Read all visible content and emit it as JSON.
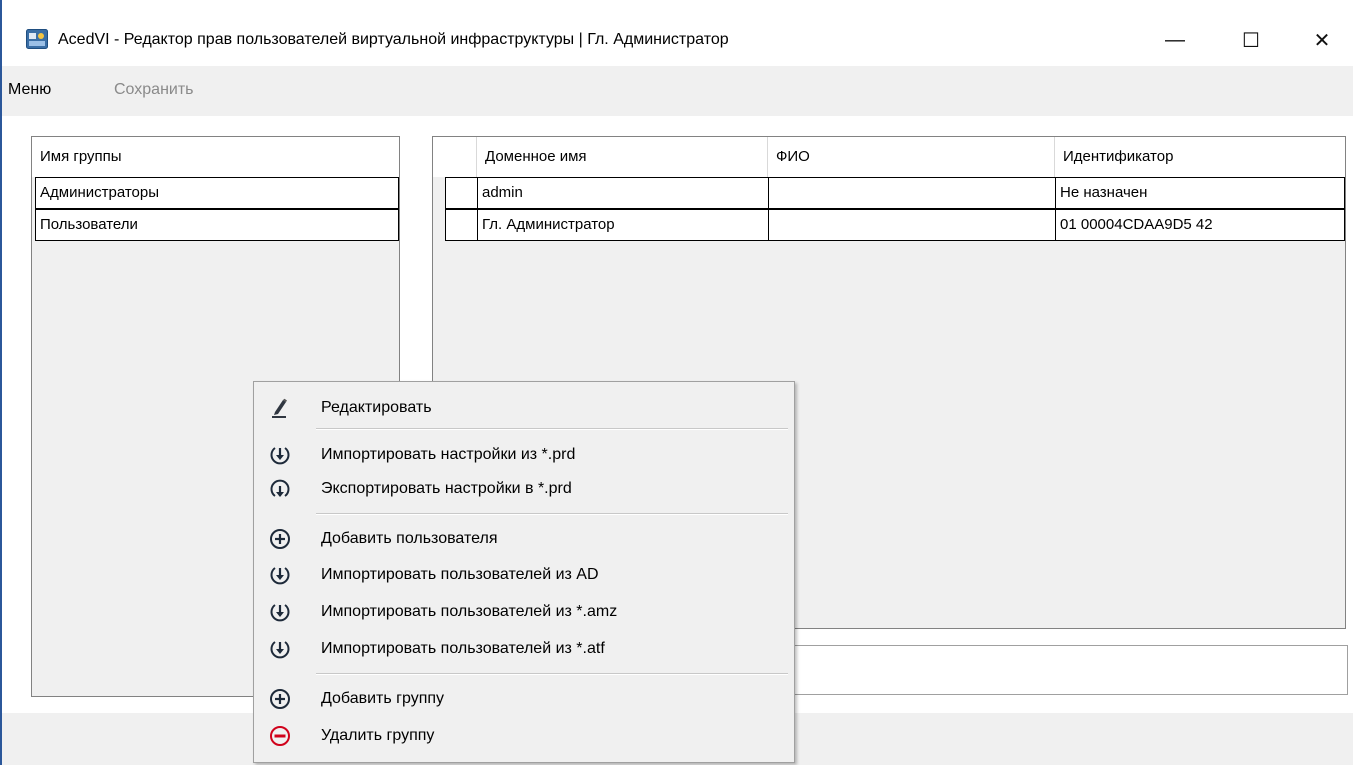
{
  "window": {
    "title": "AcedVI - Редактор прав пользователей виртуальной инфраструктуры | Гл. Администратор",
    "minimize_glyph": "—",
    "maximize_glyph": "☐",
    "close_glyph": "✕",
    "accent_color": "#2b579a"
  },
  "menu": {
    "menu_label": "Меню",
    "save_label": "Сохранить"
  },
  "groups_grid": {
    "header": "Имя группы",
    "rows": [
      "Администраторы",
      "Пользователи"
    ]
  },
  "users_grid": {
    "columns": [
      "Доменное имя",
      "ФИО",
      "Идентификатор"
    ],
    "rows": [
      {
        "domain_name": "admin",
        "full_name": "",
        "identifier": "Не назначен"
      },
      {
        "domain_name": "Гл. Администратор",
        "full_name": "",
        "identifier": "01 00004CDAA9D5 42"
      }
    ]
  },
  "context_menu": {
    "items": [
      {
        "label": "Редактировать",
        "icon": "pencil-icon"
      },
      {
        "label": "Импортировать настройки из *.prd",
        "icon": "import-icon"
      },
      {
        "label": "Экспортировать настройки в *.prd",
        "icon": "export-icon"
      },
      {
        "label": "Добавить пользователя",
        "icon": "add-icon"
      },
      {
        "label": "Импортировать пользователей из AD",
        "icon": "import-icon"
      },
      {
        "label": "Импортировать пользователей из *.amz",
        "icon": "import-icon"
      },
      {
        "label": "Импортировать пользователей из *.atf",
        "icon": "import-icon"
      },
      {
        "label": "Добавить группу",
        "icon": "add-icon"
      },
      {
        "label": "Удалить группу",
        "icon": "remove-icon"
      }
    ],
    "remove_color": "#d0021b"
  }
}
